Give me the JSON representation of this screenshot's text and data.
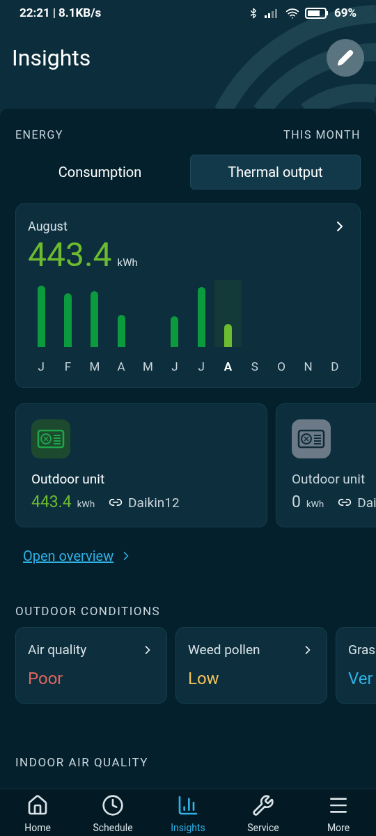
{
  "status_bar": {
    "time": "22:21",
    "separator": "|",
    "speed": "8.1KB/s",
    "battery": "69%"
  },
  "header": {
    "title": "Insights"
  },
  "energy": {
    "label": "ENERGY",
    "period": "THIS MONTH",
    "tabs": [
      {
        "label": "Consumption",
        "selected": false
      },
      {
        "label": "Thermal output",
        "selected": true
      }
    ],
    "summary": {
      "month": "August",
      "value": "443.4",
      "unit": "kWh"
    },
    "months": [
      {
        "label": "J",
        "selected": false
      },
      {
        "label": "F",
        "selected": false
      },
      {
        "label": "M",
        "selected": false
      },
      {
        "label": "A",
        "selected": false
      },
      {
        "label": "M",
        "selected": false
      },
      {
        "label": "J",
        "selected": false
      },
      {
        "label": "J",
        "selected": false
      },
      {
        "label": "A",
        "selected": true
      },
      {
        "label": "S",
        "selected": false
      },
      {
        "label": "O",
        "selected": false
      },
      {
        "label": "N",
        "selected": false
      },
      {
        "label": "D",
        "selected": false
      }
    ]
  },
  "units": [
    {
      "name": "Outdoor unit",
      "value": "443.4",
      "unit": "kWh",
      "device": "Daikin12",
      "active": true
    },
    {
      "name": "Outdoor unit",
      "value": "0",
      "unit": "kWh",
      "device": "Dai",
      "active": false
    }
  ],
  "overview_link": "Open overview",
  "outdoor": {
    "title": "OUTDOOR CONDITIONS",
    "items": [
      {
        "label": "Air quality",
        "value": "Poor",
        "color": "#e0665e"
      },
      {
        "label": "Weed pollen",
        "value": "Low",
        "color": "#f2c45a"
      },
      {
        "label": "Gras",
        "value": "Ver",
        "color": "#2fb1e6"
      }
    ]
  },
  "indoor": {
    "title": "INDOOR AIR QUALITY"
  },
  "nav": [
    {
      "label": "Home",
      "kind": "home",
      "selected": false
    },
    {
      "label": "Schedule",
      "kind": "schedule",
      "selected": false
    },
    {
      "label": "Insights",
      "kind": "insights",
      "selected": true
    },
    {
      "label": "Service",
      "kind": "service",
      "selected": false
    },
    {
      "label": "More",
      "kind": "more",
      "selected": false
    }
  ]
}
